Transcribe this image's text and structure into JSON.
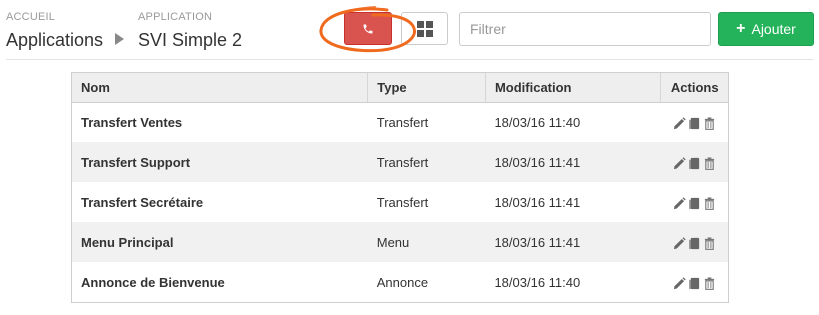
{
  "breadcrumb": {
    "root_small": "ACCUEIL",
    "root_label": "Applications",
    "app_small": "APPLICATION",
    "app_label": "SVI Simple 2"
  },
  "toolbar": {
    "phone_icon": "phone-icon",
    "grid_icon": "grid-icon",
    "filter_placeholder": "Filtrer",
    "add_label": "Ajouter",
    "colors": {
      "danger": "#d9534f",
      "success": "#24b35a",
      "annotation": "#f06a1f"
    }
  },
  "table": {
    "columns": [
      "Nom",
      "Type",
      "Modification",
      "Actions"
    ],
    "rows": [
      {
        "name": "Transfert Ventes",
        "type": "Transfert",
        "modified": "18/03/16 11:40"
      },
      {
        "name": "Transfert Support",
        "type": "Transfert",
        "modified": "18/03/16 11:41"
      },
      {
        "name": "Transfert Secrétaire",
        "type": "Transfert",
        "modified": "18/03/16 11:41"
      },
      {
        "name": "Menu Principal",
        "type": "Menu",
        "modified": "18/03/16 11:41"
      },
      {
        "name": "Annonce de Bienvenue",
        "type": "Annonce",
        "modified": "18/03/16 11:40"
      }
    ],
    "row_actions": [
      "pencil-icon",
      "copy-icon",
      "trash-icon"
    ]
  }
}
